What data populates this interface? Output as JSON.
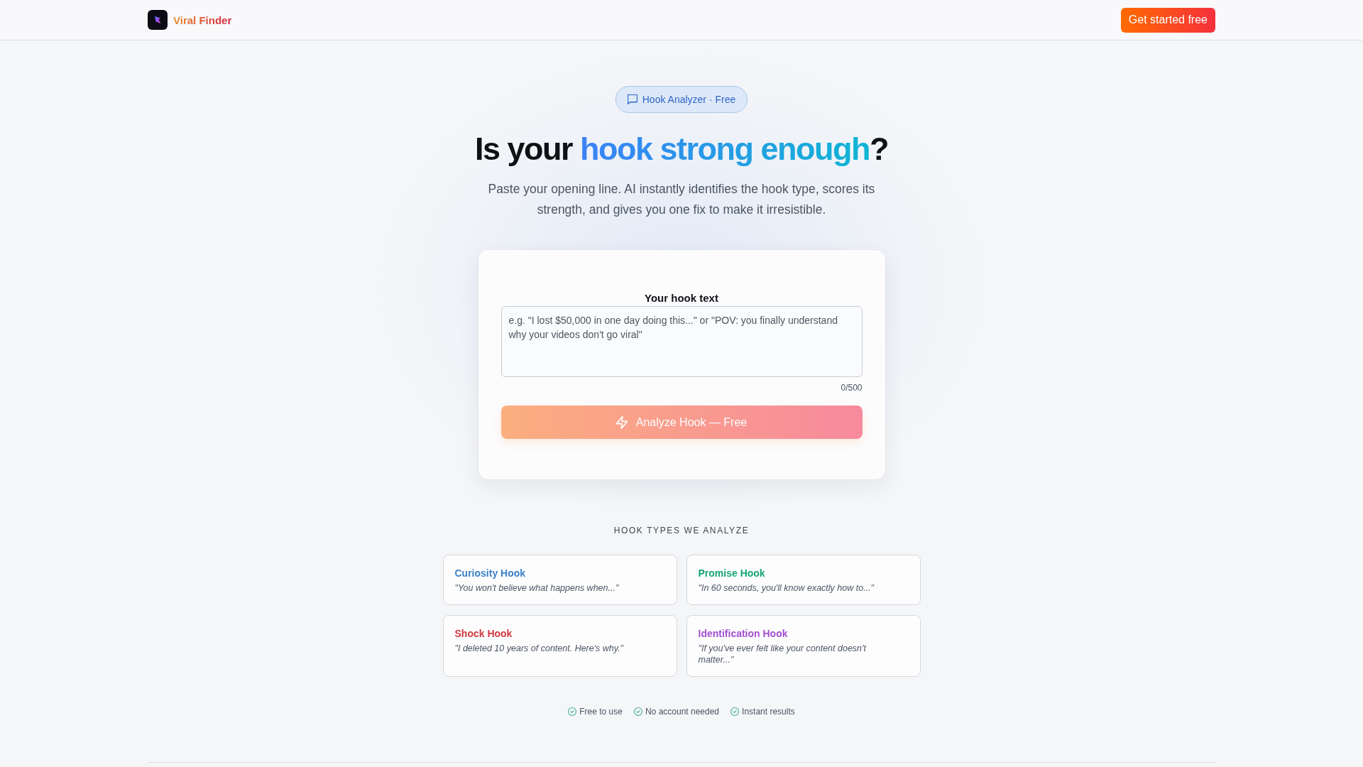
{
  "header": {
    "brand": "Viral Finder",
    "cta": "Get started free"
  },
  "hero": {
    "badge": "Hook Analyzer · Free",
    "title": {
      "lead": "Is your",
      "highlight": "hook strong enough",
      "tail": "?"
    },
    "subtitle": "Paste your opening line. AI instantly identifies the hook type, scores its strength, and gives you one fix to make it irresistible."
  },
  "analyzer": {
    "label": "Your hook text",
    "placeholder": "e.g. \"I lost $50,000 in one day doing this...\" or \"POV: you finally understand why your videos don't go viral\"",
    "counter": "0/500",
    "button": {
      "label": "Analyze Hook — Free",
      "disabled": true
    }
  },
  "hook_types": {
    "heading": "HOOK TYPES WE ANALYZE",
    "items": [
      {
        "name": "Curiosity Hook",
        "example": "\"You won't believe what happens when...\"",
        "color": "#3b80c6"
      },
      {
        "name": "Promise Hook",
        "example": "\"In 60 seconds, you'll know exactly how to...\"",
        "color": "#16a571"
      },
      {
        "name": "Shock Hook",
        "example": "\"I deleted 10 years of content. Here's why.\"",
        "color": "#cf3a40"
      },
      {
        "name": "Identification Hook",
        "example": "\"If you've ever felt like your content doesn't matter...\"",
        "color": "#a14fcf"
      }
    ]
  },
  "features": [
    "Free to use",
    "No account needed",
    "Instant results"
  ]
}
